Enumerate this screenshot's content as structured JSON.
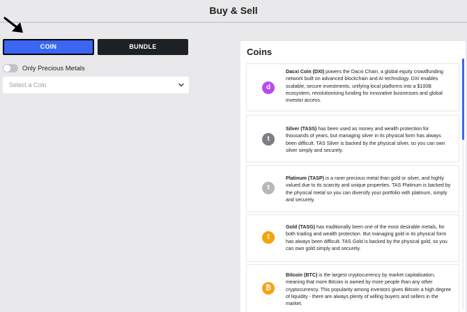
{
  "header": {
    "title": "Buy & Sell"
  },
  "tabs": {
    "coin_label": "COIN",
    "bundle_label": "BUNDLE"
  },
  "filter": {
    "only_precious_label": "Only Precious Metals",
    "toggle_on": false
  },
  "coin_select": {
    "placeholder": "Select a Coin"
  },
  "panel": {
    "title": "Coins"
  },
  "coins": [
    {
      "name": "Dacxi Coin (DXI)",
      "icon": "dacxi-coin-icon",
      "glyph": "d",
      "color": "#b64cf0",
      "description": " powers the Dacxi Chain, a global equity crowdfunding network built on advanced blockchain and AI technology. DXI enables scalable, secure investments, unifying local platforms into a $100B ecosystem, revolutionising funding for innovative businesses and global investor access."
    },
    {
      "name": "Silver (TASS)",
      "icon": "silver-coin-icon",
      "glyph": "t",
      "color": "#7c7e82",
      "description": " has been used as money and wealth protection for thousands of years, but managing silver in its physical form has always been difficult. TAS Silver is backed by the physical silver, so you can own silver simply and securely."
    },
    {
      "name": "Platinum (TASP)",
      "icon": "platinum-coin-icon",
      "glyph": "t",
      "color": "#b6b8bb",
      "description": " is a rarer precious metal than gold or silver, and highly valued due to its scarcity and unique properties. TAS Platinum is backed by the physical metal so you can diversify your portfolio with platinum, simply and securely."
    },
    {
      "name": "Gold (TASG)",
      "icon": "gold-coin-icon",
      "glyph": "t",
      "color": "#f3a40b",
      "description": " has traditionally been one of the most desirable metals, for both trading and wealth protection. But managing gold in its physical form has always been difficult. TAS Gold is backed by the physical gold, so you can own gold simply and securely."
    },
    {
      "name": "Bitcoin (BTC)",
      "icon": "bitcoin-icon",
      "glyph": "₿",
      "color": "#f7a21b",
      "description": " is the largest cryptocurrency by market capitalisation, meaning that more Bitcoin is owned by more people than any other cryptocurrency. This popularity among investors gives Bitcoin a high degree of liquidity - there are always plenty of willing buyers and sellers in the market."
    }
  ]
}
